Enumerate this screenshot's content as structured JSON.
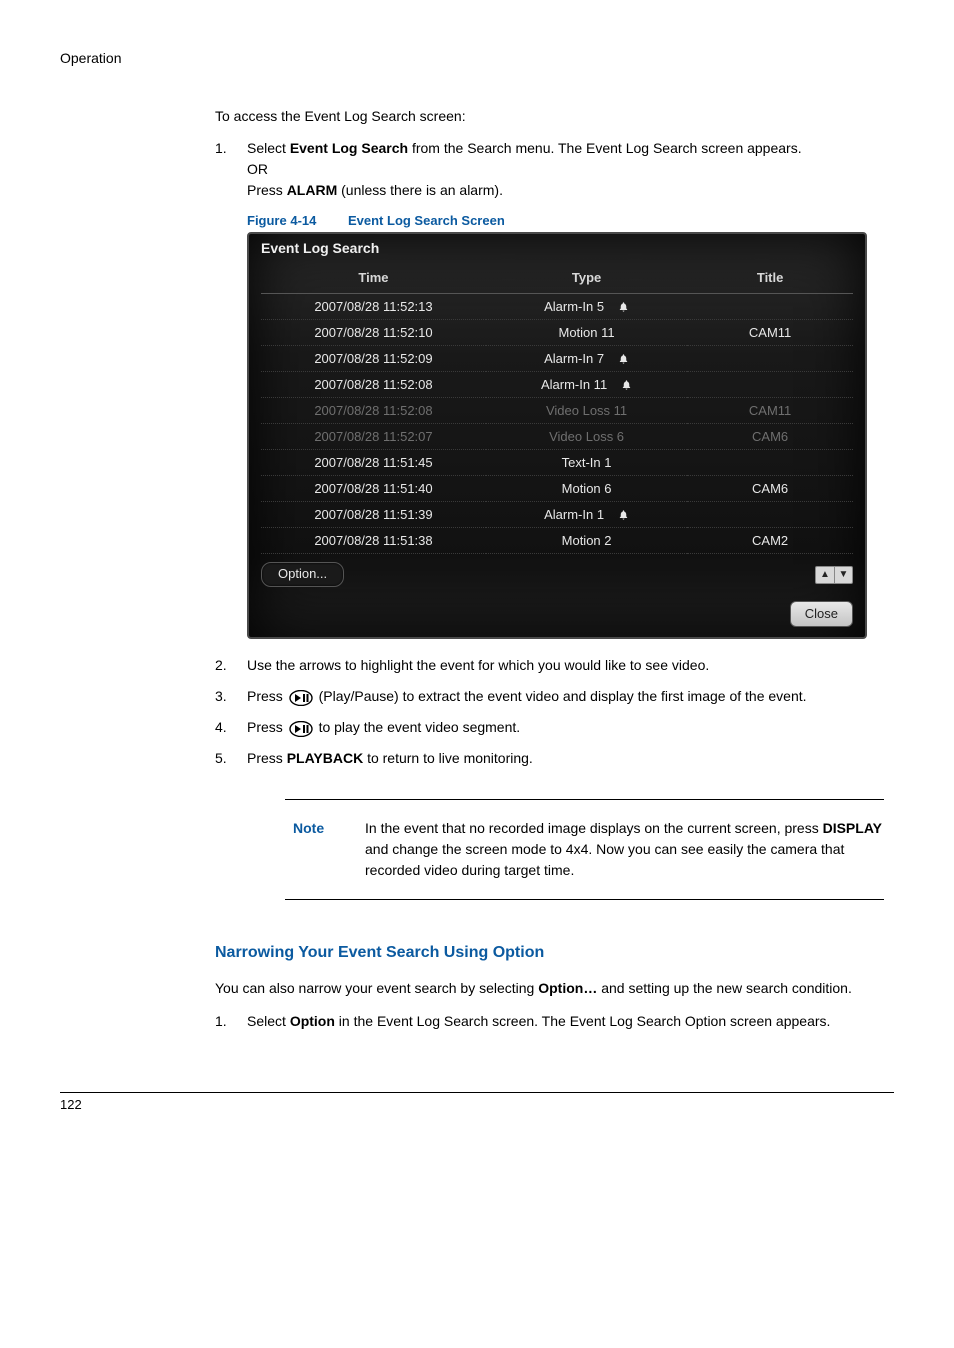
{
  "section_label": "Operation",
  "intro": "To access the Event Log Search screen:",
  "step1": {
    "num": "1.",
    "pre": "Select ",
    "bold": "Event Log Search",
    "post": " from the Search menu. The Event Log Search screen appears.",
    "or": "OR",
    "press_pre": "Press ",
    "press_bold": "ALARM",
    "press_post": " (unless there is an alarm)."
  },
  "figure": {
    "label": "Figure 4-14",
    "title": "Event Log Search Screen"
  },
  "screenshot": {
    "title": "Event Log Search",
    "headers": {
      "time": "Time",
      "type": "Type",
      "title": "Title"
    },
    "rows": [
      {
        "time": "2007/08/28  11:52:13",
        "type": "Alarm-In 5",
        "bell": true,
        "title": "",
        "dim": false
      },
      {
        "time": "2007/08/28  11:52:10",
        "type": "Motion 11",
        "bell": false,
        "title": "CAM11",
        "dim": false
      },
      {
        "time": "2007/08/28  11:52:09",
        "type": "Alarm-In 7",
        "bell": true,
        "title": "",
        "dim": false
      },
      {
        "time": "2007/08/28  11:52:08",
        "type": "Alarm-In 11",
        "bell": true,
        "title": "",
        "dim": false
      },
      {
        "time": "2007/08/28  11:52:08",
        "type": "Video Loss 11",
        "bell": false,
        "title": "CAM11",
        "dim": true
      },
      {
        "time": "2007/08/28  11:52:07",
        "type": "Video Loss 6",
        "bell": false,
        "title": "CAM6",
        "dim": true
      },
      {
        "time": "2007/08/28  11:51:45",
        "type": "Text-In 1",
        "bell": false,
        "title": "",
        "dim": false
      },
      {
        "time": "2007/08/28  11:51:40",
        "type": "Motion 6",
        "bell": false,
        "title": "CAM6",
        "dim": false
      },
      {
        "time": "2007/08/28  11:51:39",
        "type": "Alarm-In 1",
        "bell": true,
        "title": "",
        "dim": false
      },
      {
        "time": "2007/08/28  11:51:38",
        "type": "Motion 2",
        "bell": false,
        "title": "CAM2",
        "dim": false
      }
    ],
    "option_label": "Option...",
    "arrow_up": "▲",
    "arrow_down": "▼",
    "close_label": "Close"
  },
  "step2": {
    "num": "2.",
    "text": "Use the arrows to highlight the event for which you would like to see video."
  },
  "step3": {
    "num": "3.",
    "pre": "Press ",
    "post": " (Play/Pause) to extract the event video and display the first image of the event."
  },
  "step4": {
    "num": "4.",
    "pre": "Press ",
    "post": " to play the event video segment."
  },
  "step5": {
    "num": "5.",
    "pre": "Press ",
    "bold": "PLAYBACK",
    "post": " to return to live monitoring."
  },
  "note": {
    "label": "Note",
    "pre": "In the event that no recorded image displays on the current screen, press ",
    "bold": "DISPLAY",
    "post": " and change the screen mode to 4x4. Now you can see easily the camera that recorded video during target time."
  },
  "subhead": "Narrowing Your Event Search Using Option",
  "narrow_para_pre": "You can also narrow your event search by selecting ",
  "narrow_para_bold": "Option…",
  "narrow_para_post": " and setting up the new search condition.",
  "narrow_step1": {
    "num": "1.",
    "pre": "Select ",
    "bold": "Option",
    "post": " in the Event Log Search screen. The Event Log Search Option screen appears."
  },
  "page_number": "122"
}
